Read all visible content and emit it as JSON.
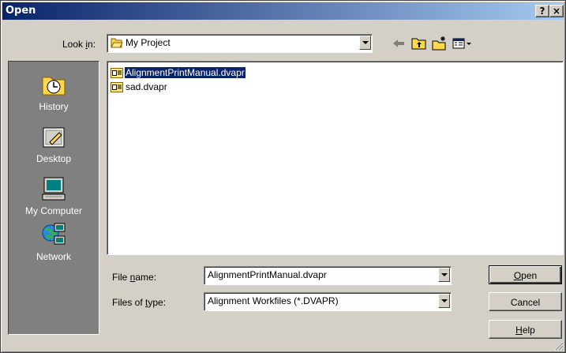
{
  "window": {
    "title": "Open",
    "help_label": "?",
    "close_label": "×"
  },
  "look_in": {
    "label": "Look in:",
    "value": "My Project"
  },
  "places": [
    {
      "label": "History",
      "icon": "history-icon"
    },
    {
      "label": "Desktop",
      "icon": "desktop-icon"
    },
    {
      "label": "My Computer",
      "icon": "my-computer-icon"
    },
    {
      "label": "Network",
      "icon": "network-icon"
    }
  ],
  "files": [
    {
      "name": "AlignmentPrintManual.dvapr",
      "selected": true
    },
    {
      "name": "sad.dvapr",
      "selected": false
    }
  ],
  "file_name": {
    "label": "File name:",
    "value": "AlignmentPrintManual.dvapr"
  },
  "file_type": {
    "label": "Files of type:",
    "value": "Alignment Workfiles (*.DVAPR)"
  },
  "buttons": {
    "open": "Open",
    "cancel": "Cancel",
    "help": "Help"
  },
  "colors": {
    "title_start": "#0a246a",
    "title_end": "#a6caf0",
    "face": "#d4d0c8",
    "places_bg": "#808080",
    "selection": "#0a246a"
  }
}
